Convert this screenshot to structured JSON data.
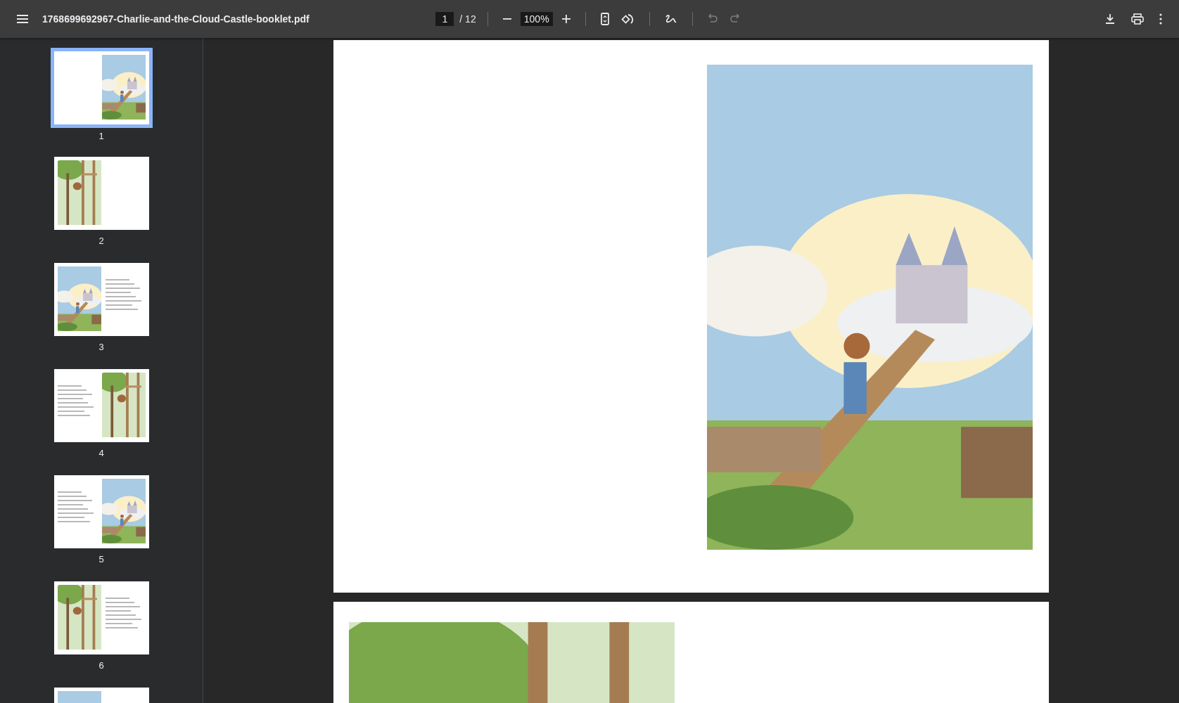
{
  "toolbar": {
    "file_name": "1768699692967-Charlie-and-the-Cloud-Castle-booklet.pdf",
    "page_number": "1",
    "page_count": "/ 12",
    "zoom": "100%",
    "undo_disabled": true,
    "redo_disabled": true
  },
  "thumbnails": [
    {
      "label": "1",
      "selected": true,
      "kind": "cover"
    },
    {
      "label": "2",
      "selected": false,
      "kind": "picture-left"
    },
    {
      "label": "3",
      "selected": false,
      "kind": "picture-left-text"
    },
    {
      "label": "4",
      "selected": false,
      "kind": "text-picture-right"
    },
    {
      "label": "5",
      "selected": false,
      "kind": "text-picture-right"
    },
    {
      "label": "6",
      "selected": false,
      "kind": "picture-left-text"
    },
    {
      "kind": "picture-left"
    }
  ],
  "pages": [
    {
      "kind": "picture-right"
    },
    {
      "kind": "picture-left"
    }
  ]
}
